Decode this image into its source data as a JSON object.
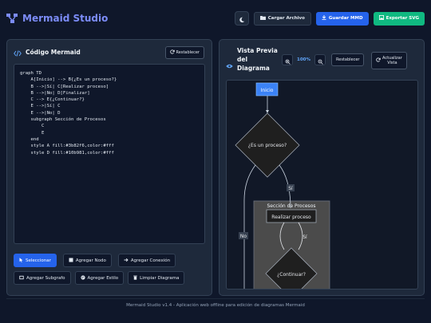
{
  "app": {
    "title": "Mermaid Studio",
    "footer": "Mermaid Studio v1.4 - Aplicación web offline para edición de diagramas Mermaid"
  },
  "header": {
    "load_label": "Cargar Archivo",
    "save_label": "Guardar MMD",
    "export_label": "Exportar SVG"
  },
  "editor": {
    "title": "Código Mermaid",
    "reset_label": "Restablecer",
    "code": "graph TD\n    A[Inicio] --> B{¿Es un proceso?}\n    B -->|Sí| C[Realizar proceso]\n    B -->|No| D[Finalizar]\n    C --> E{¿Continuar?}\n    E -->|Sí| C\n    E -->|No| D\n    subgraph Sección de Procesos\n        C\n        E\n    end\n    style A fill:#3b82f6,color:#fff\n    style D fill:#10b981,color:#fff"
  },
  "tools": {
    "select": "Seleccionar",
    "add_node": "Agregar Nodo",
    "add_connection": "Agregar Conexión",
    "add_subgraph": "Agregar Subgrafo",
    "add_style": "Agregar Estilo",
    "clear": "Limpiar Diagrama"
  },
  "preview": {
    "title_line1": "Vista Previa",
    "title_line2": "del",
    "title_line3": "Diagrama",
    "zoom": "100%",
    "reset_label": "Restablecer",
    "refresh_label_1": "Actualizar",
    "refresh_label_2": "Vista"
  },
  "diagram": {
    "node_start": "Inicio",
    "node_decision": "¿Es un proceso?",
    "edge_yes": "Sí",
    "edge_no": "No",
    "subgraph_title": "Sección de Procesos",
    "node_process": "Realizar proceso",
    "edge_yes2": "Sí",
    "node_continue": "¿Continuar?"
  },
  "colors": {
    "accent": "#2563eb",
    "success": "#10b981",
    "brand": "#7c8cf8",
    "node_start_fill": "#3b82f6"
  }
}
